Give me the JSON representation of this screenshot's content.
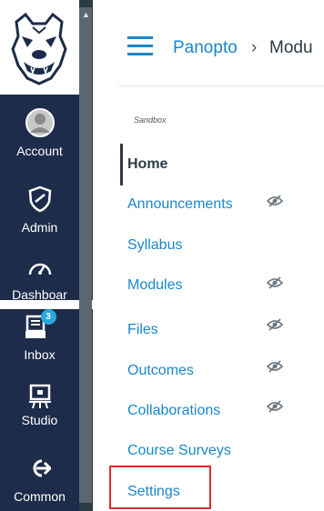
{
  "global_nav": {
    "items": [
      {
        "label": "Account",
        "icon": "user-avatar-icon"
      },
      {
        "label": "Admin",
        "icon": "admin-shield-icon"
      },
      {
        "label": "Dashboar",
        "icon": "dashboard-gauge-icon"
      },
      {
        "label": "Inbox",
        "icon": "inbox-icon",
        "badge": "3"
      },
      {
        "label": "Studio",
        "icon": "studio-icon"
      },
      {
        "label": "Common",
        "icon": "common-arrow-icon"
      }
    ]
  },
  "breadcrumb": {
    "course": "Panopto",
    "separator": "›",
    "current": "Modu"
  },
  "course_nav": {
    "term": "Sandbox",
    "links": [
      {
        "label": "Home",
        "active": true,
        "hidden_icon": false
      },
      {
        "label": "Announcements",
        "active": false,
        "hidden_icon": true
      },
      {
        "label": "Syllabus",
        "active": false,
        "hidden_icon": false
      },
      {
        "label": "Modules",
        "active": false,
        "hidden_icon": true
      },
      {
        "label": "Files",
        "active": false,
        "hidden_icon": true
      },
      {
        "label": "Outcomes",
        "active": false,
        "hidden_icon": true
      },
      {
        "label": "Collaborations",
        "active": false,
        "hidden_icon": true
      },
      {
        "label": "Course Surveys",
        "active": false,
        "hidden_icon": false
      },
      {
        "label": "Settings",
        "active": false,
        "hidden_icon": false,
        "highlighted": true
      }
    ]
  },
  "colors": {
    "nav_bg": "#1d2c4a",
    "link": "#1a86c8",
    "highlight": "#e32b2b",
    "badge": "#2aa7e0"
  }
}
